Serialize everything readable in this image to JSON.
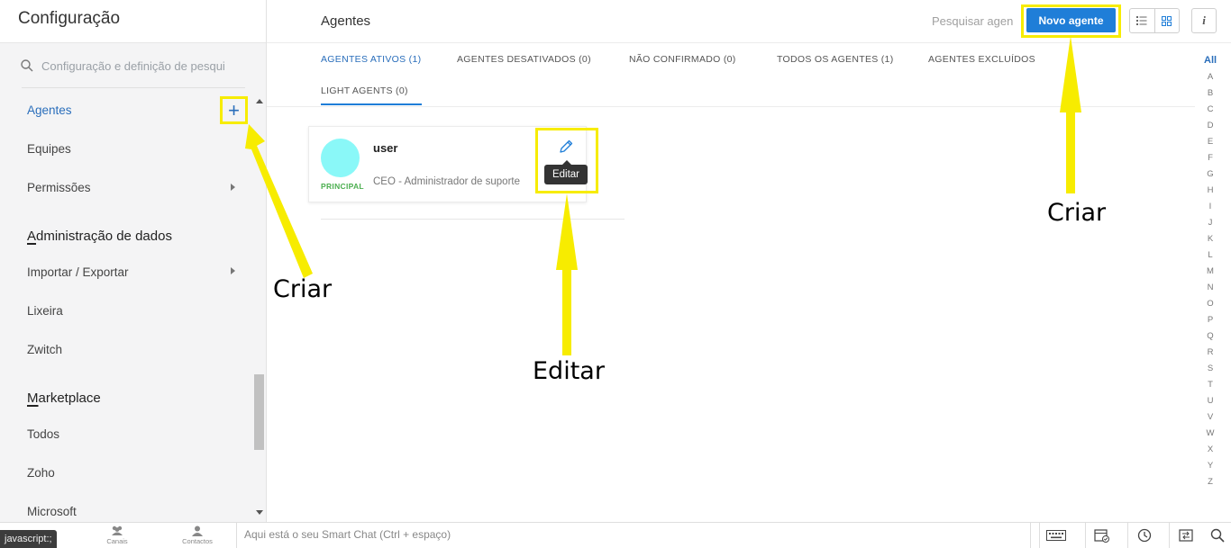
{
  "sidebar": {
    "title": "Configuração",
    "search_placeholder": "Configuração e definição de pesqui",
    "items": {
      "agentes": "Agentes",
      "equipes": "Equipes",
      "permissoes": "Permissões",
      "importar": "Importar / Exportar",
      "lixeira": "Lixeira",
      "zwitch": "Zwitch",
      "todos": "Todos",
      "zoho": "Zoho",
      "microsoft": "Microsoft"
    },
    "sections": {
      "admin_first": "A",
      "admin_rest": "dministração de dados",
      "market_first": "M",
      "market_rest": "arketplace"
    },
    "add_symbol": "+"
  },
  "header": {
    "title": "Agentes",
    "search_placeholder": "Pesquisar agen",
    "new_button": "Novo agente",
    "info_symbol": "i"
  },
  "tabs": [
    {
      "label": "AGENTES ATIVOS (1)"
    },
    {
      "label": "AGENTES DESATIVADOS (0)"
    },
    {
      "label": "NÃO CONFIRMADO (0)"
    },
    {
      "label": "TODOS OS AGENTES (1)"
    },
    {
      "label": "AGENTES EXCLUÍDOS"
    },
    {
      "label": "LIGHT AGENTS (0)"
    }
  ],
  "alphabet": {
    "all": "All",
    "letters": [
      "A",
      "B",
      "C",
      "D",
      "E",
      "F",
      "G",
      "H",
      "I",
      "J",
      "K",
      "L",
      "M",
      "N",
      "O",
      "P",
      "Q",
      "R",
      "S",
      "T",
      "U",
      "V",
      "W",
      "X",
      "Y",
      "Z"
    ]
  },
  "agent_card": {
    "name": "user",
    "role": "CEO - Administrador de suporte",
    "badge": "PRINCIPAL",
    "tooltip": "Editar",
    "avatar_color": "#8af8f8"
  },
  "annotations": {
    "criar_left": "Criar",
    "editar": "Editar",
    "criar_right": "Criar",
    "highlight_color": "#f7ec00"
  },
  "bottombar": {
    "status": "javascript:;",
    "canais": "Canais",
    "contactos": "Contactos",
    "smart_chat": "Aqui está o seu Smart Chat (Ctrl + espaço)"
  },
  "colors": {
    "accent": "#1f7ed8",
    "link": "#2a6ebb",
    "principal": "#4caf50"
  }
}
